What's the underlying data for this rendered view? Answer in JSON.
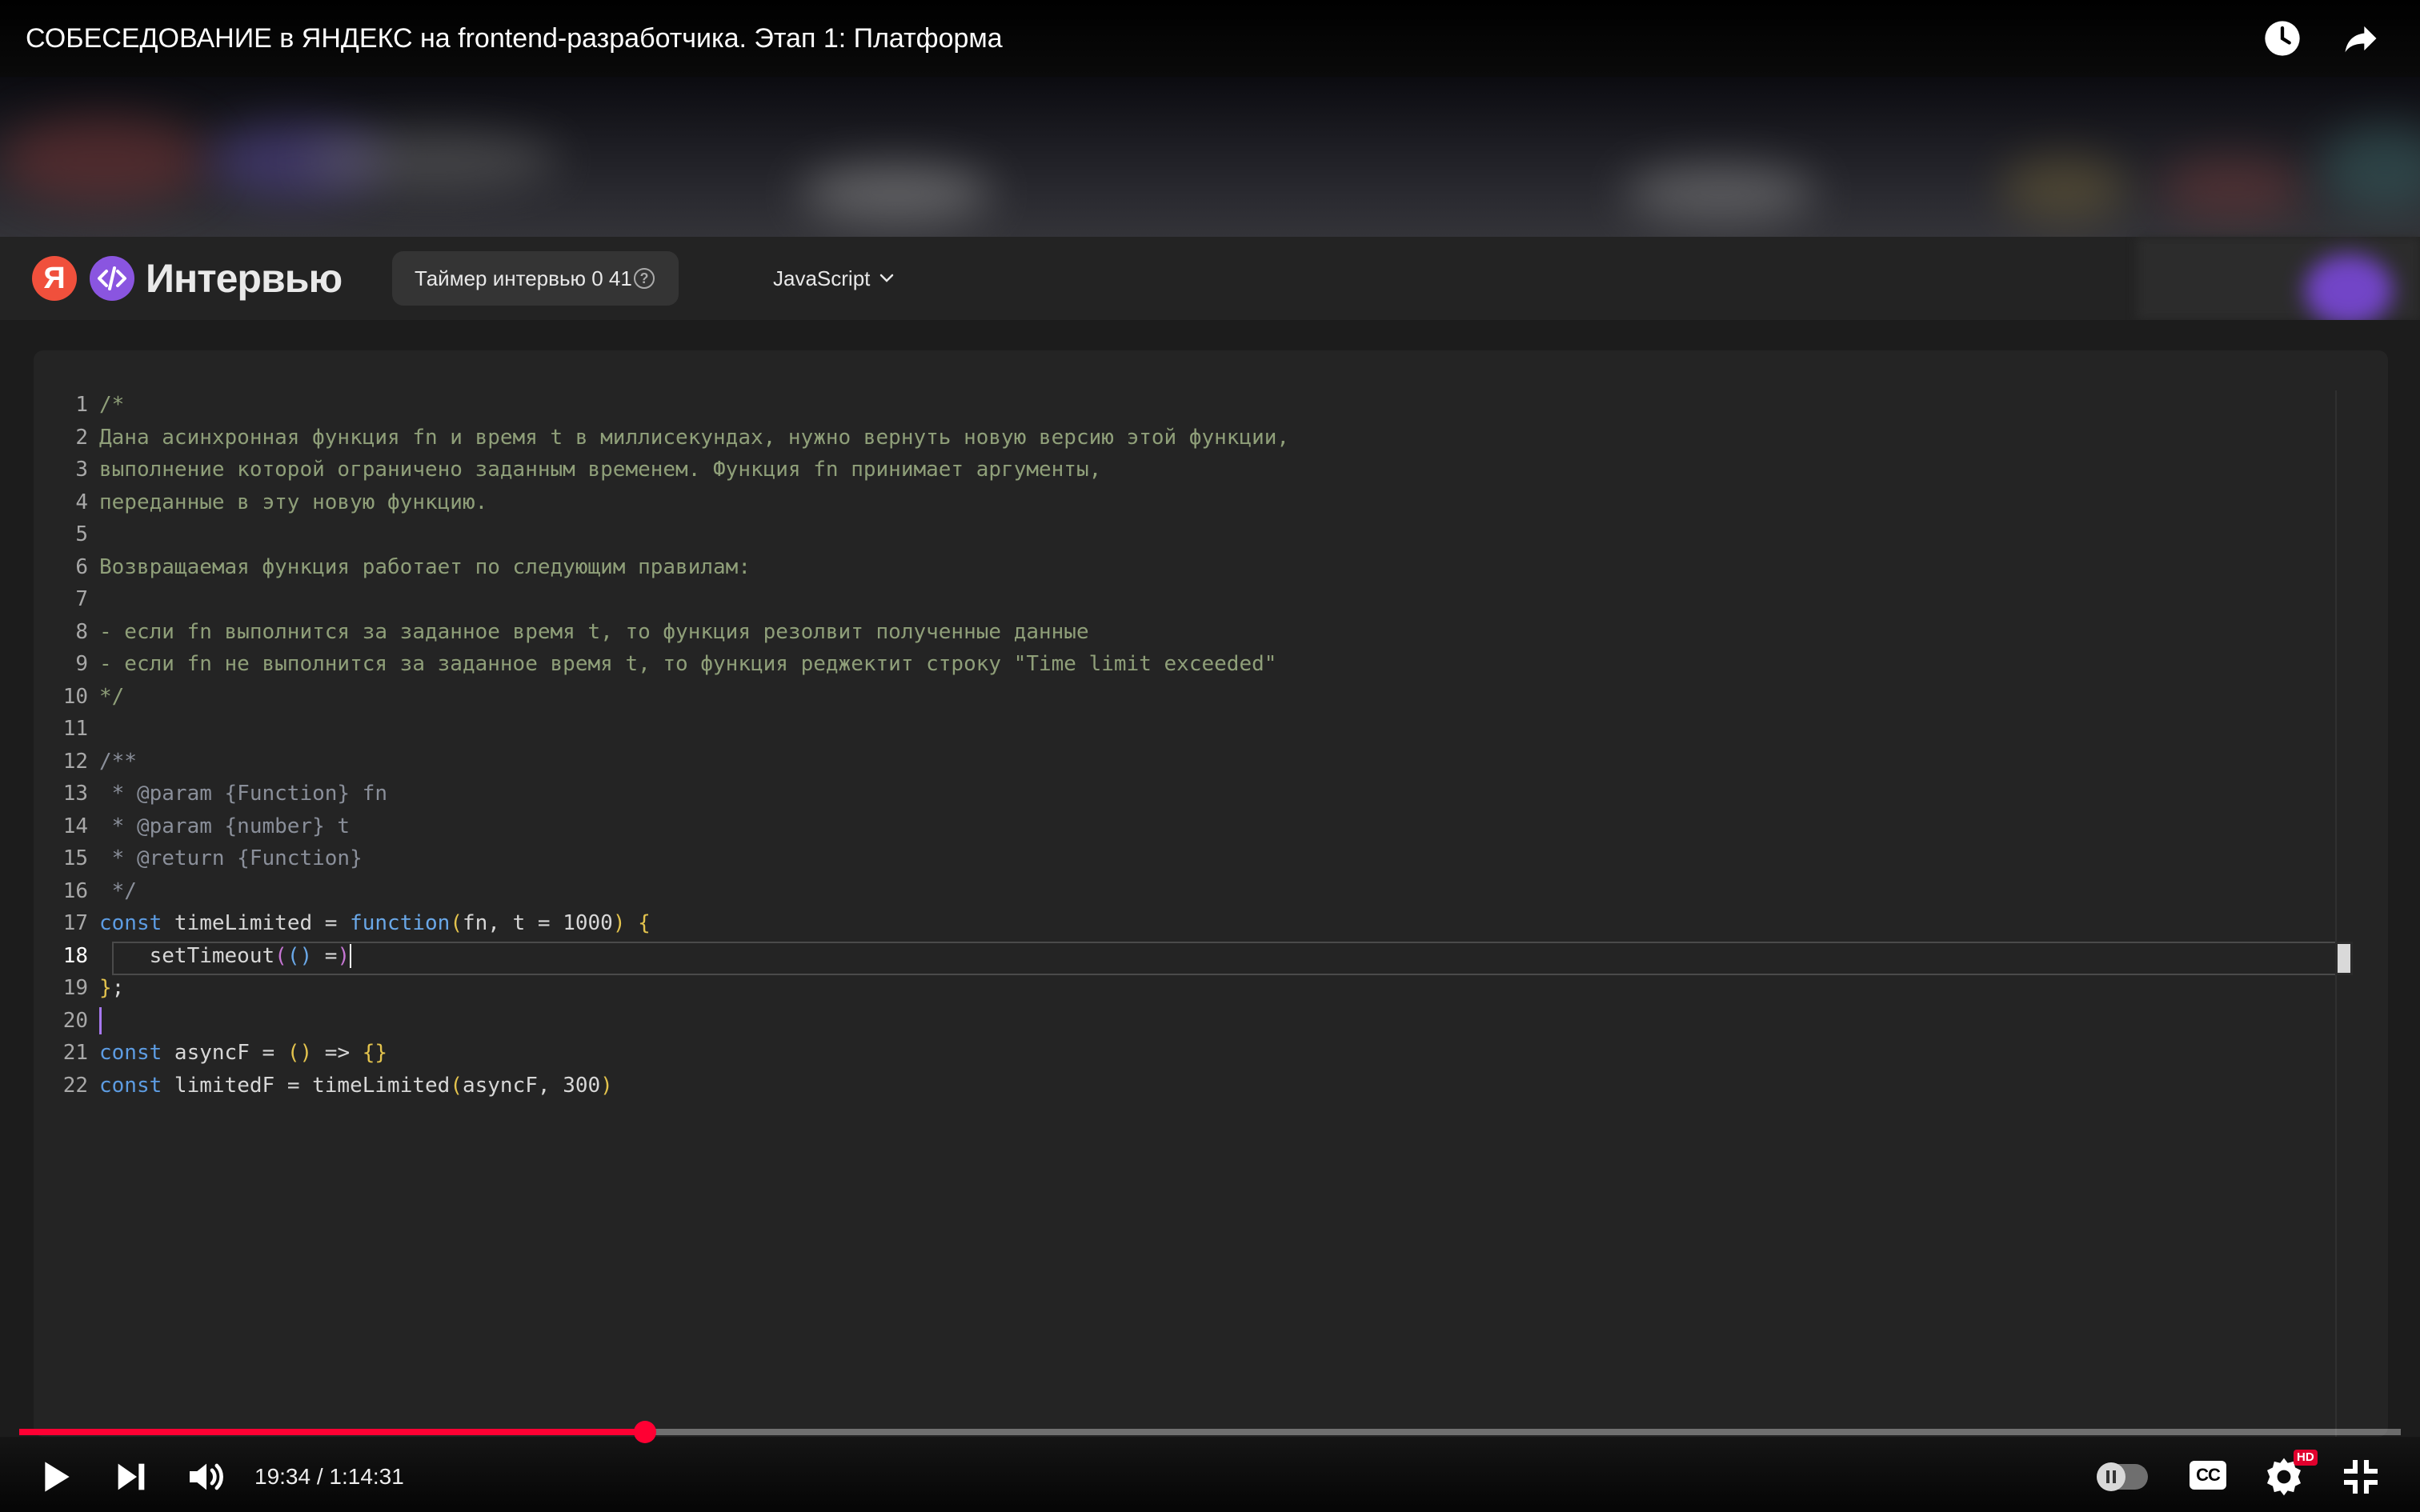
{
  "video": {
    "title": "СОБЕСЕДОВАНИЕ в ЯНДЕКС на frontend-разработчика. Этап 1: Платформа",
    "time_display": "19:34 / 1:14:31",
    "progress_fraction": 0.2627,
    "hd_badge": "HD",
    "cc_label": "CC",
    "accent_color": "#ff0033"
  },
  "top_icons": [
    "watch-later-icon",
    "share-icon"
  ],
  "controls": [
    "play-icon",
    "next-icon",
    "volume-icon",
    "autoplay-toggle",
    "subtitles-icon",
    "settings-icon",
    "exit-fullscreen-icon"
  ],
  "app": {
    "logo_letter": "Я",
    "brand": "Интервью",
    "timer_label": "Таймер интервью 0 41",
    "help_glyph": "?",
    "language": "JavaScript"
  },
  "editor": {
    "active_line": 18,
    "lines": [
      {
        "n": "1",
        "tokens": [
          {
            "t": "/*",
            "c": "c-com"
          }
        ]
      },
      {
        "n": "2",
        "tokens": [
          {
            "t": "Дана асинхронная функция fn и время t в миллисекундах, нужно вернуть новую версию этой функции,",
            "c": "c-com"
          }
        ]
      },
      {
        "n": "3",
        "tokens": [
          {
            "t": "выполнение которой ограничено заданным временем. Функция fn принимает аргументы,",
            "c": "c-com"
          }
        ]
      },
      {
        "n": "4",
        "tokens": [
          {
            "t": "переданные в эту новую функцию.",
            "c": "c-com"
          }
        ]
      },
      {
        "n": "5",
        "tokens": []
      },
      {
        "n": "6",
        "tokens": [
          {
            "t": "Возвращаемая функция работает по следующим правилам:",
            "c": "c-com"
          }
        ]
      },
      {
        "n": "7",
        "tokens": []
      },
      {
        "n": "8",
        "tokens": [
          {
            "t": "- если fn выполнится за заданное время t, то функция резолвит полученные данные",
            "c": "c-com"
          }
        ]
      },
      {
        "n": "9",
        "tokens": [
          {
            "t": "- если fn не выполнится за заданное время t, то функция реджектит строку \"Time limit exceeded\"",
            "c": "c-com"
          }
        ]
      },
      {
        "n": "10",
        "tokens": [
          {
            "t": "*/",
            "c": "c-com"
          }
        ]
      },
      {
        "n": "11",
        "tokens": []
      },
      {
        "n": "12",
        "tokens": [
          {
            "t": "/**",
            "c": "c-doc"
          }
        ]
      },
      {
        "n": "13",
        "tokens": [
          {
            "t": " * @param {Function} fn",
            "c": "c-doc"
          }
        ]
      },
      {
        "n": "14",
        "tokens": [
          {
            "t": " * @param {number} t",
            "c": "c-doc"
          }
        ]
      },
      {
        "n": "15",
        "tokens": [
          {
            "t": " * @return {Function}",
            "c": "c-doc"
          }
        ]
      },
      {
        "n": "16",
        "tokens": [
          {
            "t": " */",
            "c": "c-doc"
          }
        ]
      },
      {
        "n": "17",
        "tokens": [
          {
            "t": "const",
            "c": "c-kw"
          },
          {
            "t": " timeLimited = ",
            "c": "src"
          },
          {
            "t": "function",
            "c": "c-fn"
          },
          {
            "t": "(",
            "c": "c-br"
          },
          {
            "t": "fn, t = 1000",
            "c": "src"
          },
          {
            "t": ")",
            "c": "c-br"
          },
          {
            "t": " ",
            "c": "src"
          },
          {
            "t": "{",
            "c": "c-br"
          }
        ]
      },
      {
        "n": "18",
        "tokens": [
          {
            "t": "    setTimeout",
            "c": "src"
          },
          {
            "t": "(",
            "c": "c-br2"
          },
          {
            "t": "()",
            "c": "c-fn"
          },
          {
            "t": " =",
            "c": "src"
          },
          {
            "t": ")",
            "c": "c-br2"
          },
          {
            "caret": "white"
          }
        ]
      },
      {
        "n": "19",
        "tokens": [
          {
            "t": "}",
            "c": "c-br"
          },
          {
            "t": ";",
            "c": "src"
          }
        ]
      },
      {
        "n": "20",
        "tokens": [
          {
            "caret": "purple"
          }
        ]
      },
      {
        "n": "21",
        "tokens": [
          {
            "t": "const",
            "c": "c-kw"
          },
          {
            "t": " asyncF = ",
            "c": "src"
          },
          {
            "t": "()",
            "c": "c-br"
          },
          {
            "t": " => ",
            "c": "src"
          },
          {
            "t": "{}",
            "c": "c-br"
          }
        ]
      },
      {
        "n": "22",
        "tokens": [
          {
            "t": "const",
            "c": "c-kw"
          },
          {
            "t": " limitedF = timeLimited",
            "c": "src"
          },
          {
            "t": "(",
            "c": "c-br"
          },
          {
            "t": "asyncF, 300",
            "c": "src"
          },
          {
            "t": ")",
            "c": "c-br"
          }
        ]
      }
    ]
  }
}
